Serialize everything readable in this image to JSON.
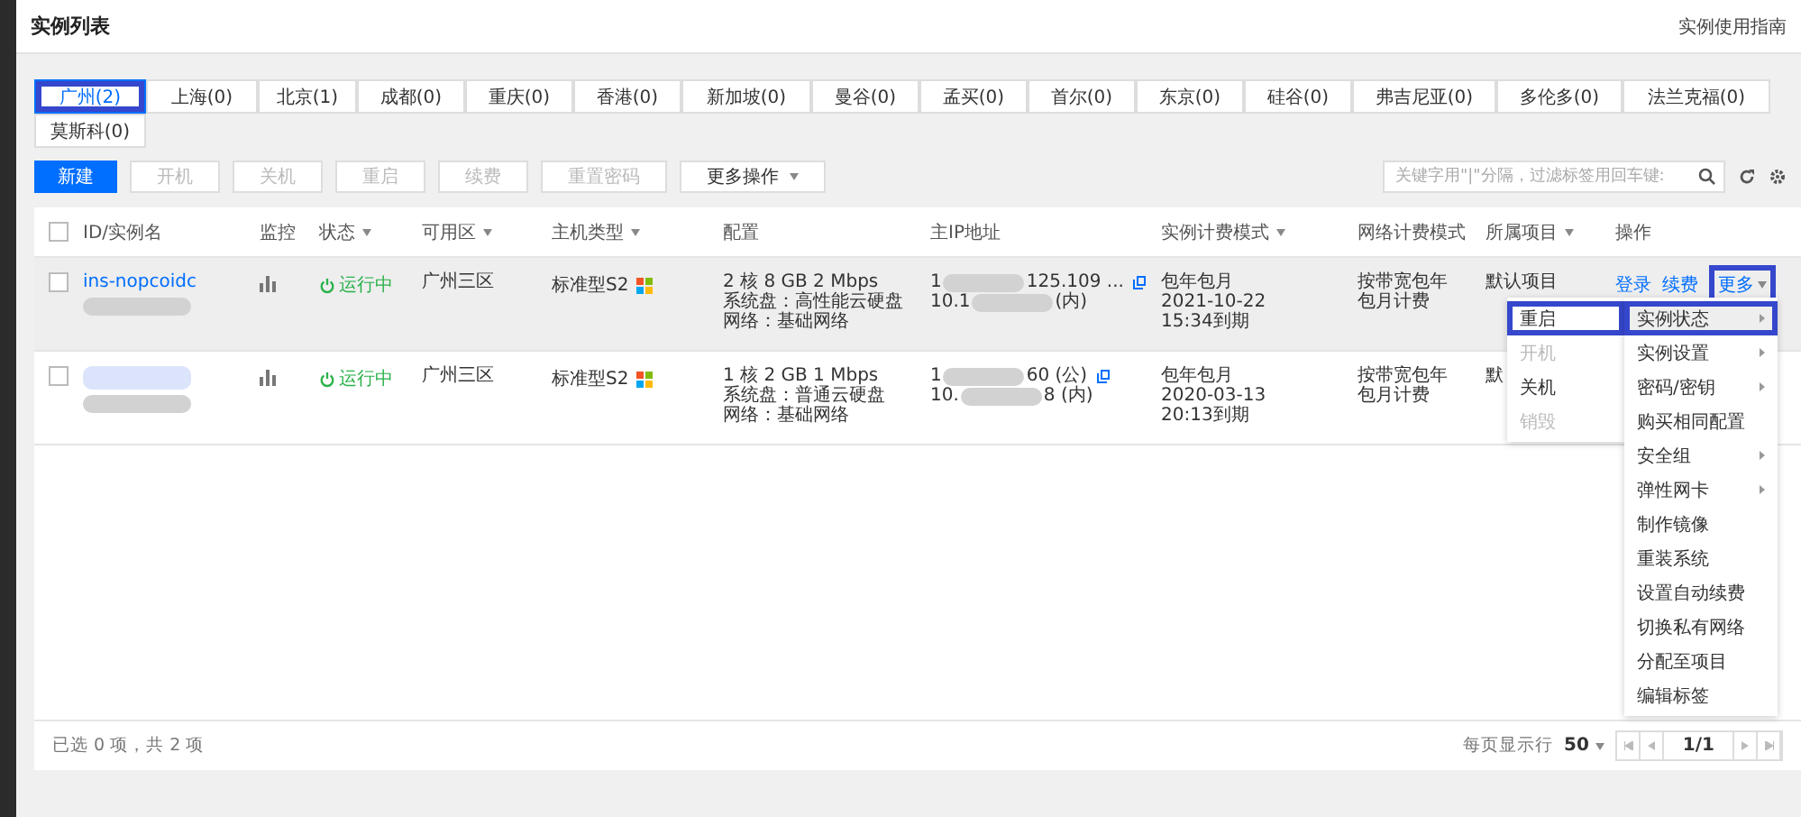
{
  "page": {
    "title": "实例列表",
    "guide_link": "实例使用指南"
  },
  "regions": [
    {
      "label": "广州(2)",
      "selected": true,
      "highlighted": true
    },
    {
      "label": "上海(0)",
      "selected": false
    },
    {
      "label": "北京(1)",
      "selected": false
    },
    {
      "label": "成都(0)",
      "selected": false
    },
    {
      "label": "重庆(0)",
      "selected": false
    },
    {
      "label": "香港(0)",
      "selected": false
    },
    {
      "label": "新加坡(0)",
      "selected": false
    },
    {
      "label": "曼谷(0)",
      "selected": false
    },
    {
      "label": "孟买(0)",
      "selected": false
    },
    {
      "label": "首尔(0)",
      "selected": false
    },
    {
      "label": "东京(0)",
      "selected": false
    },
    {
      "label": "硅谷(0)",
      "selected": false
    },
    {
      "label": "弗吉尼亚(0)",
      "selected": false
    },
    {
      "label": "多伦多(0)",
      "selected": false
    },
    {
      "label": "法兰克福(0)",
      "selected": false
    },
    {
      "label": "莫斯科(0)",
      "selected": false
    }
  ],
  "toolbar": {
    "buttons": [
      {
        "label": "新建",
        "kind": "primary"
      },
      {
        "label": "开机",
        "kind": "disabled"
      },
      {
        "label": "关机",
        "kind": "disabled"
      },
      {
        "label": "重启",
        "kind": "disabled"
      },
      {
        "label": "续费",
        "kind": "disabled"
      },
      {
        "label": "重置密码",
        "kind": "disabled"
      },
      {
        "label": "更多操作",
        "kind": "dropdown"
      }
    ],
    "search": {
      "placeholder": "关键字用\"|\"分隔，过滤标签用回车键:"
    }
  },
  "table": {
    "select_all_checked": false,
    "columns": [
      {
        "label": "ID/实例名",
        "filter": false
      },
      {
        "label": "监控",
        "filter": false
      },
      {
        "label": "状态",
        "filter": true
      },
      {
        "label": "可用区",
        "filter": true
      },
      {
        "label": "主机类型",
        "filter": true
      },
      {
        "label": "配置",
        "filter": false
      },
      {
        "label": "主IP地址",
        "filter": false
      },
      {
        "label": "实例计费模式",
        "filter": true
      },
      {
        "label": "网络计费模式",
        "filter": false
      },
      {
        "label": "所属项目",
        "filter": true
      },
      {
        "label": "操作",
        "filter": false
      }
    ],
    "rows": [
      {
        "checked": false,
        "hovered": true,
        "id": "ins-nopcoidc",
        "status": "运行中",
        "zone": "广州三区",
        "type": "标准型S2",
        "config": [
          "2 核 8 GB 2 Mbps",
          "系统盘：高性能云硬盘",
          "网络：基础网络"
        ],
        "ip": [
          {
            "prefix": "1",
            "suffix": "125.109 ..."
          },
          {
            "prefix": "10.1",
            "suffix": "(内)"
          }
        ],
        "billing": [
          "包年包月",
          "2021-10-22",
          "15:34到期"
        ],
        "net_billing": [
          "按带宽包年",
          "包月计费"
        ],
        "project": "默认项目",
        "actions": [
          "登录",
          "续费"
        ],
        "more": {
          "label": "更多",
          "highlighted": true
        }
      },
      {
        "checked": false,
        "hovered": false,
        "id": "",
        "status": "运行中",
        "zone": "广州三区",
        "type": "标准型S2",
        "config": [
          "1 核 2 GB 1 Mbps",
          "系统盘：普通云硬盘",
          "网络：基础网络"
        ],
        "ip": [
          {
            "prefix": "1",
            "suffix": "60 (公)"
          },
          {
            "prefix": "10.",
            "suffix": "8 (内)"
          }
        ],
        "billing": [
          "包年包月",
          "2020-03-13",
          "20:13到期"
        ],
        "net_billing": [
          "按带宽包年",
          "包月计费"
        ],
        "project": "默",
        "actions": []
      }
    ]
  },
  "menu": {
    "submenu": [
      {
        "label": "重启",
        "disabled": false,
        "highlighted": true
      },
      {
        "label": "开机",
        "disabled": true
      },
      {
        "label": "关机",
        "disabled": false
      },
      {
        "label": "销毁",
        "disabled": true
      }
    ],
    "items": [
      {
        "label": "实例状态",
        "has_submenu": true,
        "selected": true,
        "highlighted": true
      },
      {
        "label": "实例设置",
        "has_submenu": true,
        "selected": false
      },
      {
        "label": "密码/密钥",
        "has_submenu": true,
        "selected": false
      },
      {
        "label": "购买相同配置",
        "has_submenu": false,
        "selected": false
      },
      {
        "label": "安全组",
        "has_submenu": true,
        "selected": false
      },
      {
        "label": "弹性网卡",
        "has_submenu": true,
        "selected": false
      },
      {
        "label": "制作镜像",
        "has_submenu": false,
        "selected": false
      },
      {
        "label": "重装系统",
        "has_submenu": false,
        "selected": false
      },
      {
        "label": "设置自动续费",
        "has_submenu": false,
        "selected": false
      },
      {
        "label": "切换私有网络",
        "has_submenu": false,
        "selected": false
      },
      {
        "label": "分配至项目",
        "has_submenu": false,
        "selected": false
      },
      {
        "label": "编辑标签",
        "has_submenu": false,
        "selected": false
      }
    ]
  },
  "footer": {
    "summary": "已选 0 项，共 2 项",
    "page_size_label": "每页显示行",
    "page_size": "50",
    "page": "1/1"
  }
}
